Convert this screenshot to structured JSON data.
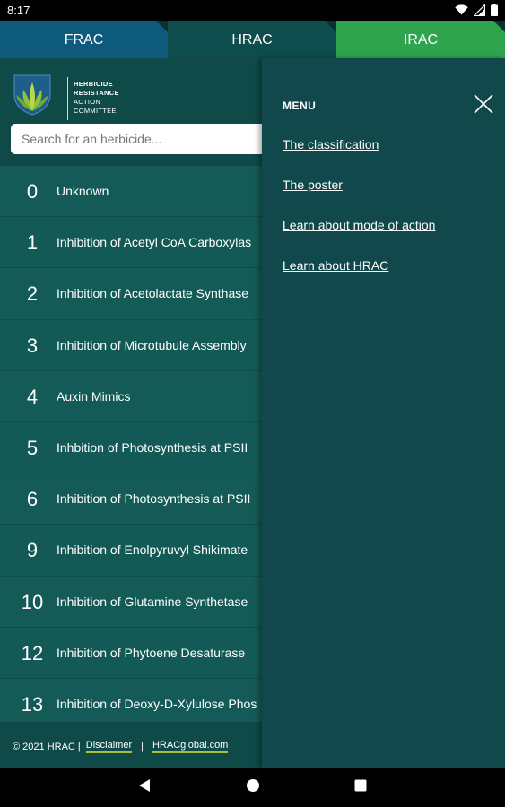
{
  "status_bar": {
    "time": "8:17"
  },
  "tabs": [
    {
      "label": "FRAC"
    },
    {
      "label": "HRAC"
    },
    {
      "label": "IRAC"
    }
  ],
  "logo": {
    "line1": "HERBICIDE",
    "line2": "RESISTANCE",
    "line3": "ACTION",
    "line4": "COMMITTEE"
  },
  "search": {
    "placeholder": "Search for an herbicide..."
  },
  "list": [
    {
      "num": "0",
      "label": "Unknown"
    },
    {
      "num": "1",
      "label": "Inhibition of Acetyl CoA Carboxylas"
    },
    {
      "num": "2",
      "label": "Inhibition of Acetolactate Synthase"
    },
    {
      "num": "3",
      "label": "Inhibition of Microtubule Assembly"
    },
    {
      "num": "4",
      "label": "Auxin Mimics"
    },
    {
      "num": "5",
      "label": "Inhbition of Photosynthesis at PSII"
    },
    {
      "num": "6",
      "label": "Inhibition of Photosynthesis at PSII"
    },
    {
      "num": "9",
      "label": "Inhibition of Enolpyruvyl Shikimate"
    },
    {
      "num": "10",
      "label": "Inhibition of Glutamine Synthetase"
    },
    {
      "num": "12",
      "label": "Inhibition of Phytoene Desaturase"
    },
    {
      "num": "13",
      "label": "Inhibition of Deoxy-D-Xylulose Phos"
    }
  ],
  "footer": {
    "copyright": "© 2021 HRAC |",
    "disclaimer": "Disclaimer",
    "separator": "|",
    "website": "HRACglobal.com"
  },
  "menu": {
    "title": "MENU",
    "items": [
      {
        "label": "The classification"
      },
      {
        "label": "The poster"
      },
      {
        "label": "Learn about mode of action"
      },
      {
        "label": "Learn about HRAC"
      }
    ]
  },
  "colors": {
    "frac_tab": "#0d5a7d",
    "hrac_tab": "#0e4d4d",
    "irac_tab": "#2ea44f",
    "background": "#135a56",
    "menu_panel": "#10484b",
    "accent": "#a7c13d"
  }
}
